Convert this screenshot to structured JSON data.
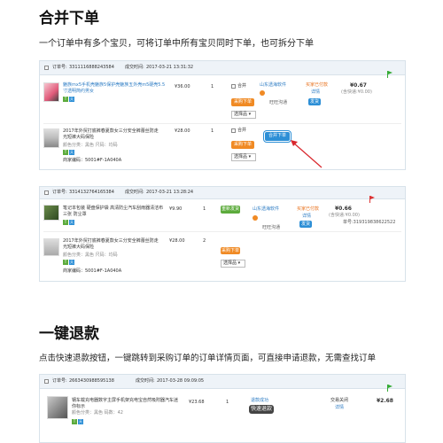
{
  "section1": {
    "heading": "合并下单",
    "description": "一个订单中有多个宝贝，可将订单中所有宝贝同时下单，也可拆分下单"
  },
  "panel1": {
    "order_label": "订单号:",
    "order_no": "3311116888243584",
    "deal_time_label": "成交时间:",
    "deal_time": "2017-03-21 13:31:32",
    "items": [
      {
        "title": "魅族mx5手机壳魅族5保护壳魅族五外壳m5硬壳5.5寸透明简约男女",
        "price": "¥36.00",
        "qty": "1",
        "checkbox_label": "合并",
        "order_btn": "采购下单",
        "select": "选择品"
      },
      {
        "title": "2017年外贸打底裤春夏款女三分安全裤蕾丝防走光短裤大码保险",
        "meta1": "颜色分类：黑色 尺码：均码",
        "meta2": "商家编码：5001#F-1A040A",
        "price": "¥28.00",
        "qty": "1",
        "checkbox_label": "合并",
        "order_btn": "采购下单",
        "select": "选择品"
      }
    ],
    "merge_btn": "合并下单",
    "buyer": "山东透海软件",
    "seller_tag": "旺旺沟通",
    "status": "买家已付款",
    "detail": "详情",
    "service": "发货",
    "total": "¥0.67",
    "shipping": "(含快递:¥0.00)"
  },
  "panel2": {
    "order_label": "订单号:",
    "order_no": "3314132764165384",
    "deal_time_label": "成交时间:",
    "deal_time": "2017-03-21 13:28:24",
    "items": [
      {
        "title": "笔记本包装 硬盘保护袋 高清防尘汽车刮雨器清洁布三张 防尘罩",
        "price": "¥9.90",
        "qty": "1",
        "order_btn": "采购下单",
        "green_btn": "重新发货"
      },
      {
        "title": "2017年外贸打底裤春夏款女三分安全裤蕾丝防走光短裤大码保险",
        "meta1": "颜色分类：黑色 尺码：均码",
        "meta2": "商家编码：5001#F-1A040A",
        "price": "¥28.00",
        "qty": "2",
        "order_btn": "采购下单",
        "select": "选择品"
      }
    ],
    "buyer": "山东透海软件",
    "seller_tag": "旺旺沟通",
    "status": "买家已付款",
    "detail": "详情",
    "service": "发货",
    "total": "¥0.66",
    "shipping": "(含快递:¥0.00)",
    "tracking": "单号:319319838622522"
  },
  "section2": {
    "heading": "一键退款",
    "description": "点击快速退款按钮，一键跳转到采购订单的订单详情页面，可直接申请退款，无需查找订单"
  },
  "panel3": {
    "order_label": "订单号:",
    "order_no": "2663430988595138",
    "deal_time_label": "成交时间:",
    "deal_time": "2017-03-28 09:09:05",
    "item": {
      "title": "钢车载充电器数字主屏手机架充电宝自然吸附器汽车迷你标示",
      "meta1": "颜色分类：黑色  码数：42",
      "price": "¥23.68",
      "qty": "1",
      "status_top": "退款成功",
      "refund_btn": "快速退款",
      "trade_status": "交易关闭",
      "detail": "详情",
      "total": "¥2.68"
    }
  },
  "colors": {
    "orange": "#f08a24",
    "blue": "#2d8fd6",
    "green": "#5cab3c",
    "red_arrow": "#d9262c"
  }
}
